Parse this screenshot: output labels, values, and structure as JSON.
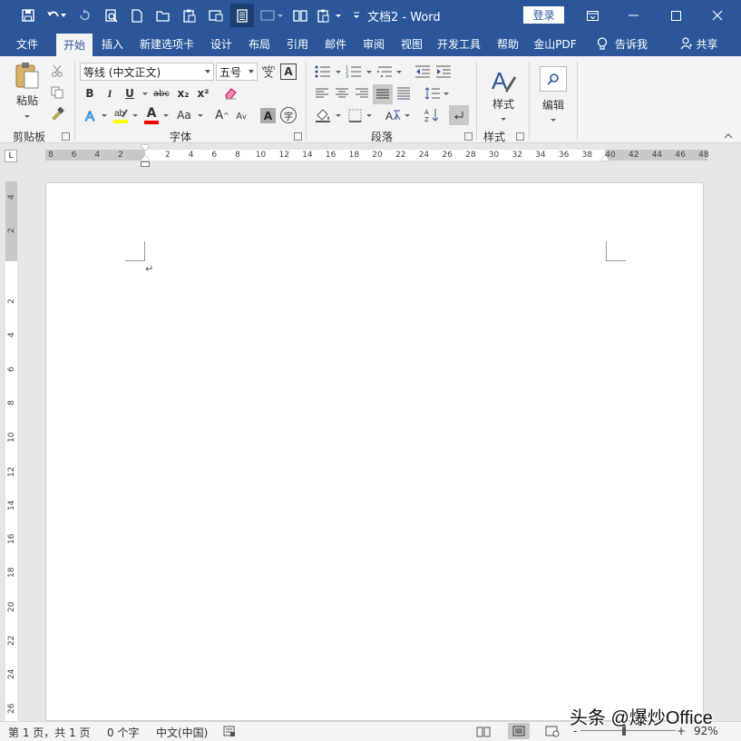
{
  "window": {
    "title": "文档2  -  Word",
    "login_label": "登录"
  },
  "tabs": [
    {
      "label": "文件"
    },
    {
      "label": "开始",
      "active": true
    },
    {
      "label": "插入"
    },
    {
      "label": "新建选项卡"
    },
    {
      "label": "设计"
    },
    {
      "label": "布局"
    },
    {
      "label": "引用"
    },
    {
      "label": "邮件"
    },
    {
      "label": "审阅"
    },
    {
      "label": "视图"
    },
    {
      "label": "开发工具"
    },
    {
      "label": "帮助"
    },
    {
      "label": "金山PDF"
    },
    {
      "label": "告诉我"
    },
    {
      "label": "共享"
    }
  ],
  "ribbon": {
    "clipboard": {
      "group_label": "剪贴板",
      "paste_label": "粘贴"
    },
    "font": {
      "group_label": "字体",
      "font_name": "等线 (中文正文)",
      "font_size": "五号",
      "bold": "B",
      "italic": "I",
      "underline": "U",
      "strike": "abc",
      "subscript": "x₂",
      "superscript": "x²",
      "grow": "A",
      "shrink": "A",
      "aa": "Aa",
      "phonetic": "wén\n文",
      "border_a": "A",
      "char_shade": "A",
      "enclose": "字"
    },
    "paragraph": {
      "group_label": "段落"
    },
    "styles": {
      "group_label": "样式",
      "styles_label": "样式"
    },
    "editing": {
      "editing_label": "编辑"
    }
  },
  "ruler": {
    "h_left": [
      "8",
      "6",
      "4",
      "2"
    ],
    "h_right": [
      "2",
      "4",
      "6",
      "8",
      "10",
      "12",
      "14",
      "16",
      "18",
      "20",
      "22",
      "24",
      "26",
      "28",
      "30",
      "32",
      "34",
      "36",
      "38",
      "40",
      "42",
      "44",
      "46",
      "48"
    ],
    "v_top": [
      "4",
      "2"
    ],
    "v_body": [
      "2",
      "4",
      "6",
      "8",
      "10",
      "12",
      "14",
      "16",
      "18",
      "20",
      "22",
      "24",
      "26"
    ]
  },
  "document": {
    "paragraph_mark": "↵"
  },
  "status": {
    "page": "第 1 页，共 1 页",
    "words": "0 个字",
    "language": "中文(中国)",
    "zoom": "92%",
    "zoom_minus": "-",
    "zoom_plus": "+"
  },
  "watermark": "头条 @爆炒Office",
  "colors": {
    "accent": "#2b579a",
    "highlight": "#ffff00",
    "font_color": "#ff0000"
  }
}
